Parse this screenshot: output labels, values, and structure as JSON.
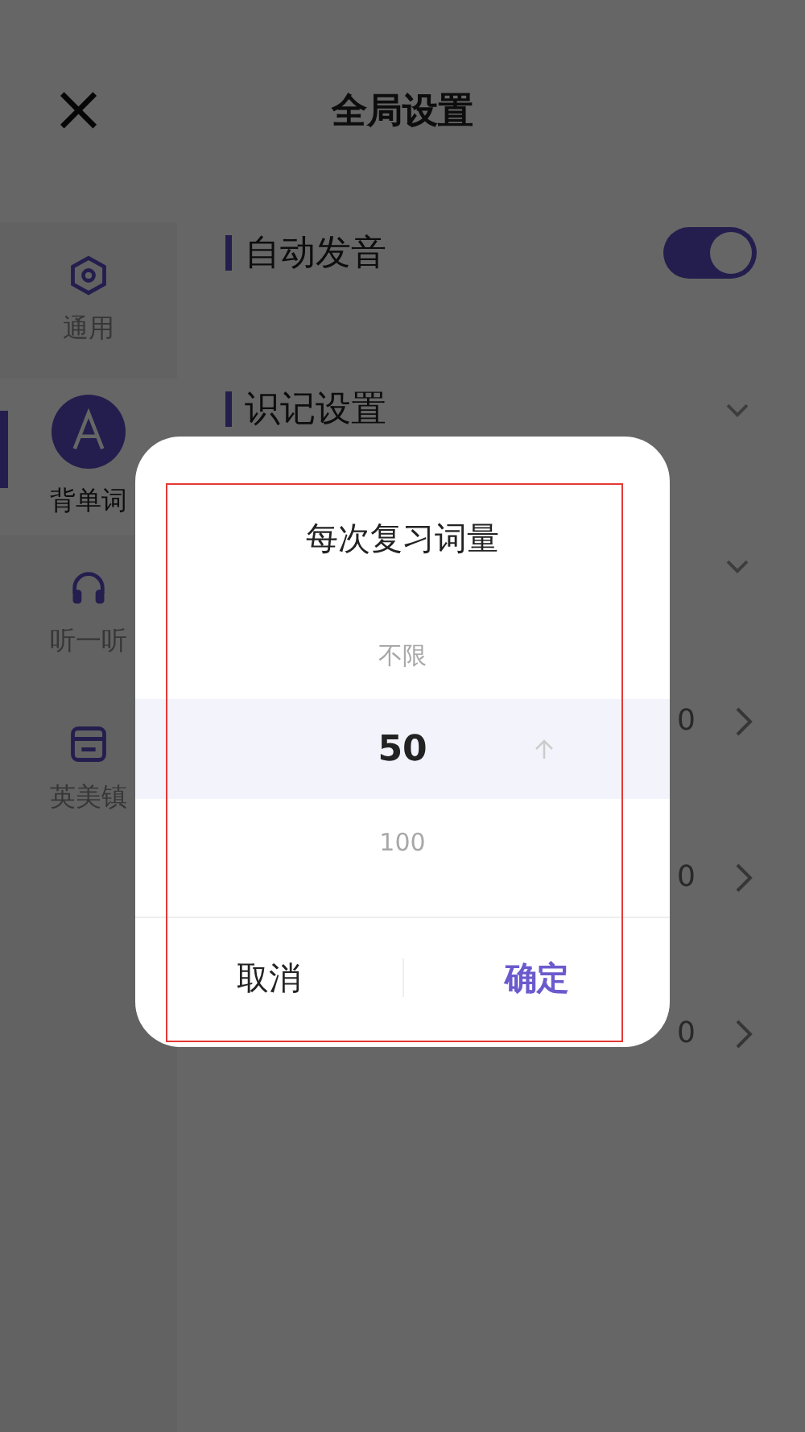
{
  "header": {
    "close": "×",
    "title": "全局设置"
  },
  "sidebar": {
    "items": [
      {
        "label": "通用",
        "selected": false
      },
      {
        "label": "背单词",
        "selected": true
      },
      {
        "label": "听一听",
        "selected": false
      },
      {
        "label": "英美镇",
        "selected": false
      }
    ]
  },
  "settings": [
    {
      "kind": "toggle",
      "label": "自动发音",
      "on": true
    },
    {
      "kind": "group",
      "label": "识记设置"
    },
    {
      "kind": "group"
    },
    {
      "kind": "link",
      "value": "0"
    },
    {
      "kind": "link",
      "value": "0"
    },
    {
      "kind": "link",
      "value": "0"
    }
  ],
  "dialog": {
    "title": "每次复习词量",
    "options": [
      {
        "label": "不限",
        "selected": false
      },
      {
        "label": "50",
        "selected": true
      },
      {
        "label": "100",
        "selected": false
      }
    ],
    "buttons": [
      {
        "label": "取消",
        "primary": false
      },
      {
        "label": "确定",
        "primary": true
      }
    ]
  }
}
